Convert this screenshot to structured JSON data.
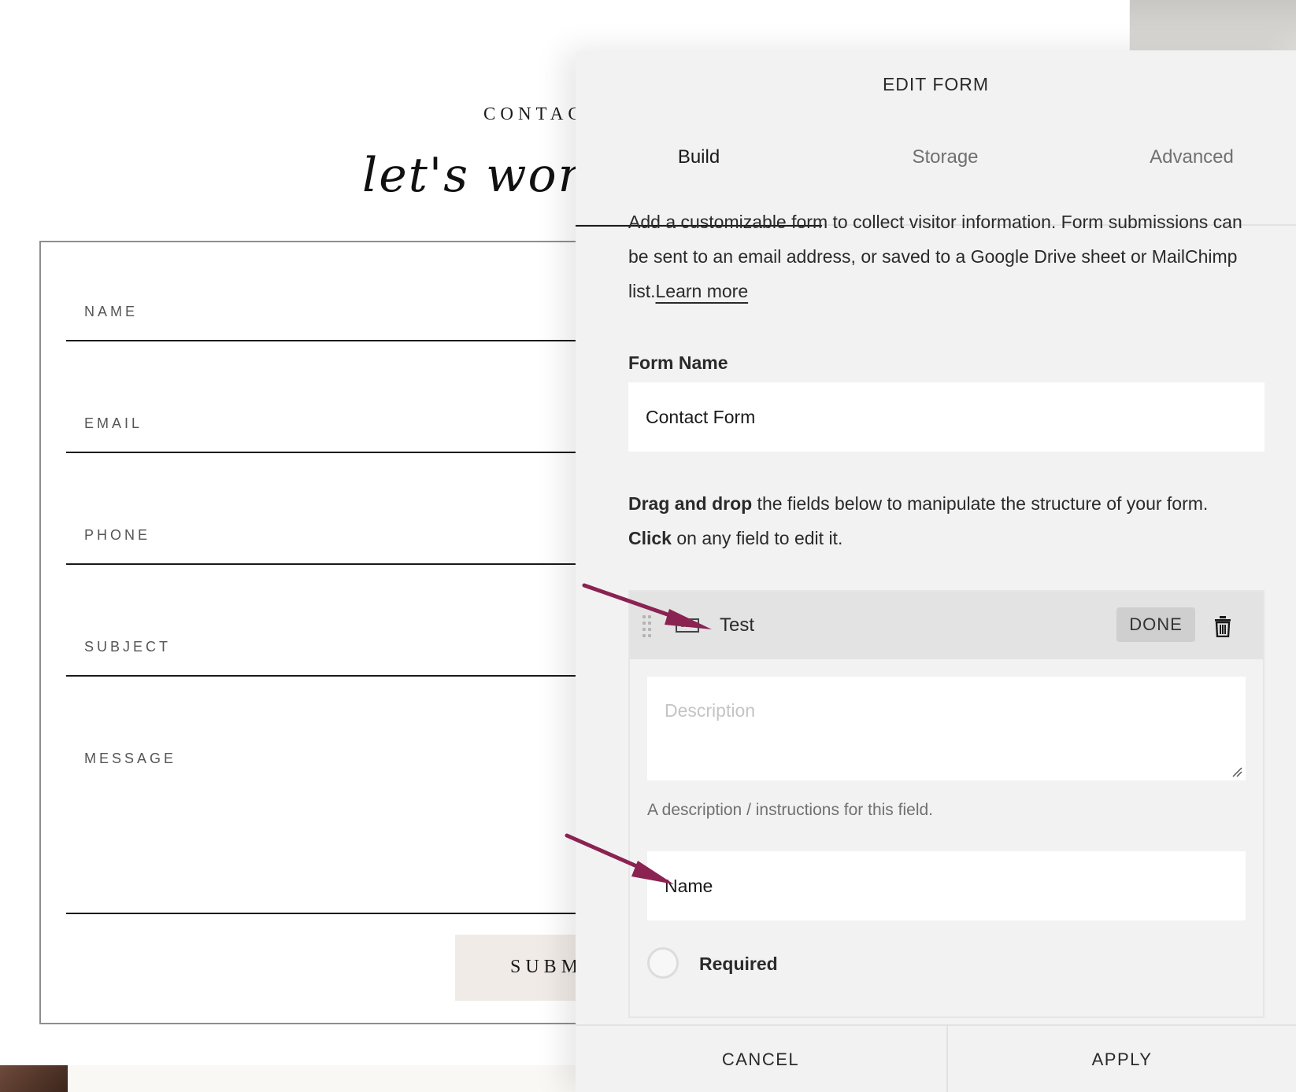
{
  "background": {
    "contact_eyebrow": "CONTAC",
    "script_heading": "let's work",
    "fields": [
      "NAME",
      "EMAIL",
      "PHONE",
      "SUBJECT",
      "MESSAGE"
    ],
    "submit_label": "SUBM"
  },
  "panel": {
    "title": "EDIT FORM",
    "tabs": [
      "Build",
      "Storage",
      "Advanced"
    ],
    "active_tab": "Build",
    "intro_text": "Add a customizable form to collect visitor information. Form submissions can be sent to an email address, or saved to a Google Drive sheet or MailChimp list.",
    "learn_more": "Learn more",
    "form_name_label": "Form Name",
    "form_name_value": "Contact Form",
    "dnd_bold_1": "Drag and drop",
    "dnd_text_1": " the fields below to manipulate the structure of your form. ",
    "dnd_bold_2": "Click",
    "dnd_text_2": " on any field to edit it.",
    "field": {
      "icon": "abc-icon",
      "title": "Test",
      "done_label": "DONE",
      "description_placeholder": "Description",
      "description_help": "A description / instructions for this field.",
      "name_value": "Name",
      "required_label": "Required"
    },
    "cancel_label": "CANCEL",
    "apply_label": "APPLY"
  },
  "colors": {
    "annotation_arrow": "#8a2252",
    "panel_bg": "#f2f2f2",
    "submit_bg": "#f0ebe6"
  }
}
